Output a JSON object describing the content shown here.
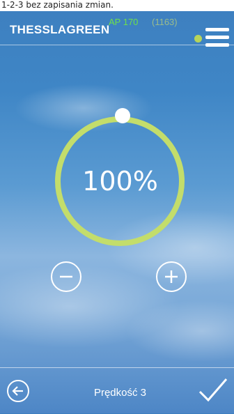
{
  "caption": "1-2-3 bez zapisania zmian.",
  "header": {
    "brand": "THESSLAGREEN",
    "model": "AP 170",
    "code": "(1163)",
    "status_color": "#b7d45a"
  },
  "gauge": {
    "value_percent": 100,
    "value_label": "100%",
    "ring_color": "#c3dd6b"
  },
  "controls": {
    "decrease_icon": "minus-circle-icon",
    "increase_icon": "plus-circle-icon"
  },
  "footer": {
    "back_icon": "arrow-left-circle-icon",
    "speed_label": "Prędkość 3",
    "confirm_icon": "checkmark-icon"
  }
}
